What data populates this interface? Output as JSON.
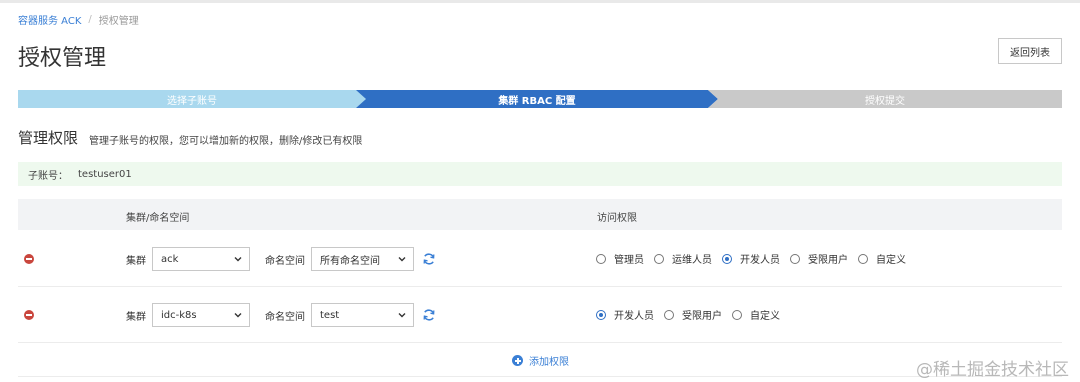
{
  "breadcrumb": {
    "root": "容器服务 ACK",
    "current": "授权管理"
  },
  "page": {
    "title": "授权管理",
    "back_label": "返回列表"
  },
  "steps": [
    {
      "label": "选择子账号",
      "state": "done"
    },
    {
      "label": "集群 RBAC 配置",
      "state": "active"
    },
    {
      "label": "授权提交",
      "state": "pending"
    }
  ],
  "section": {
    "title": "管理权限",
    "description": "管理子账号的权限，您可以增加新的权限，删除/修改已有权限"
  },
  "subaccount": {
    "label": "子账号：",
    "value": "testuser01"
  },
  "table": {
    "headers": [
      "集群/命名空间",
      "访问权限"
    ],
    "rows": [
      {
        "cluster_label": "集群",
        "cluster": "ack",
        "namespace_label": "命名空间",
        "namespace": "所有命名空间",
        "roles": [
          {
            "label": "管理员",
            "checked": false
          },
          {
            "label": "运维人员",
            "checked": false
          },
          {
            "label": "开发人员",
            "checked": true
          },
          {
            "label": "受限用户",
            "checked": false
          },
          {
            "label": "自定义",
            "checked": false
          }
        ]
      },
      {
        "cluster_label": "集群",
        "cluster": "idc-k8s",
        "namespace_label": "命名空间",
        "namespace": "test",
        "roles": [
          {
            "label": "开发人员",
            "checked": true
          },
          {
            "label": "受限用户",
            "checked": false
          },
          {
            "label": "自定义",
            "checked": false
          }
        ]
      }
    ]
  },
  "add_label": "添加权限",
  "watermark": "@稀土掘金技术社区",
  "colors": {
    "accent": "#2f6fc4",
    "step_done": "#a9d8ee",
    "step_pending": "#c9c9c9",
    "danger": "#c9463d",
    "success_bg": "#eef9ee"
  }
}
